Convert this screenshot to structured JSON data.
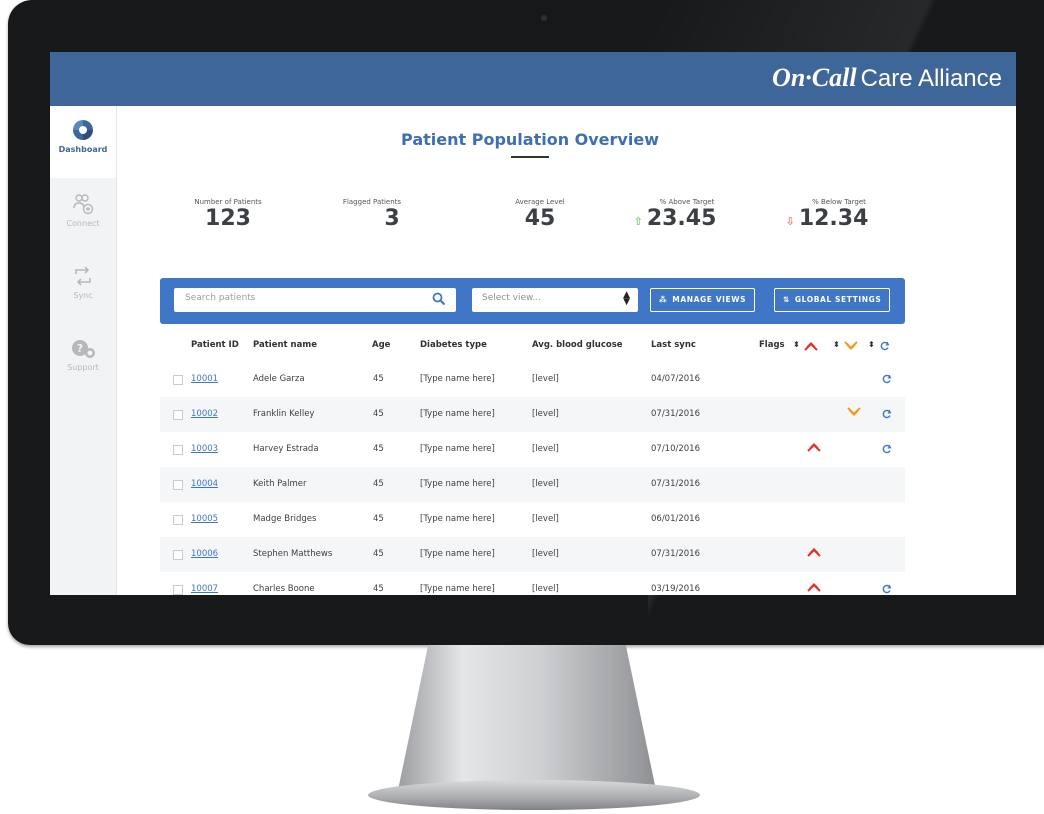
{
  "app": {
    "brand_main": "On·Call",
    "brand_sub": "Care Alliance"
  },
  "sidebar": {
    "items": [
      {
        "label": "Dashboard",
        "icon": "dashboard-icon",
        "active": true
      },
      {
        "label": "Connect",
        "icon": "connect-icon",
        "active": false
      },
      {
        "label": "Sync",
        "icon": "sync-icon",
        "active": false
      },
      {
        "label": "Support",
        "icon": "support-icon",
        "active": false
      }
    ]
  },
  "page": {
    "title": "Patient Population Overview"
  },
  "stats": [
    {
      "label": "Number of Patients",
      "value": "123"
    },
    {
      "label": "Flagged Patients",
      "value": "3"
    },
    {
      "label": "Average Level",
      "value": "45"
    },
    {
      "label": "% Above Target",
      "value": "23.45",
      "trend": "up"
    },
    {
      "label": "% Below Target",
      "value": "12.34",
      "trend": "down"
    }
  ],
  "toolbar": {
    "search_placeholder": "Search patients",
    "view_placeholder": "Select view...",
    "manage_views": "MANAGE VIEWS",
    "global_settings": "GLOBAL SETTINGS"
  },
  "table": {
    "columns": [
      "Patient ID",
      "Patient name",
      "Age",
      "Diabetes type",
      "Avg. blood glucose",
      "Last sync",
      "Flags"
    ],
    "rows": [
      {
        "id": "10001",
        "name": "Adele Garza",
        "age": "45",
        "type": "[Type name here]",
        "glucose": "[level]",
        "sync": "04/07/2016",
        "red": false,
        "orange": false,
        "syncflag": true
      },
      {
        "id": "10002",
        "name": "Franklin Kelley",
        "age": "45",
        "type": "[Type name here]",
        "glucose": "[level]",
        "sync": "07/31/2016",
        "red": false,
        "orange": true,
        "syncflag": true
      },
      {
        "id": "10003",
        "name": "Harvey Estrada",
        "age": "45",
        "type": "[Type name here]",
        "glucose": "[level]",
        "sync": "07/10/2016",
        "red": true,
        "orange": false,
        "syncflag": true
      },
      {
        "id": "10004",
        "name": "Keith Palmer",
        "age": "45",
        "type": "[Type name here]",
        "glucose": "[level]",
        "sync": "07/31/2016",
        "red": false,
        "orange": false,
        "syncflag": false
      },
      {
        "id": "10005",
        "name": "Madge Bridges",
        "age": "45",
        "type": "[Type name here]",
        "glucose": "[level]",
        "sync": "06/01/2016",
        "red": false,
        "orange": false,
        "syncflag": false
      },
      {
        "id": "10006",
        "name": "Stephen Matthews",
        "age": "45",
        "type": "[Type name here]",
        "glucose": "[level]",
        "sync": "07/31/2016",
        "red": true,
        "orange": false,
        "syncflag": false
      },
      {
        "id": "10007",
        "name": "Charles Boone",
        "age": "45",
        "type": "[Type name here]",
        "glucose": "[level]",
        "sync": "03/19/2016",
        "red": true,
        "orange": false,
        "syncflag": true
      }
    ]
  },
  "colors": {
    "brand_blue": "#3f6698",
    "toolbar_blue": "#3f77c6",
    "flag_red": "#e0312b",
    "flag_orange": "#f39a1e"
  }
}
